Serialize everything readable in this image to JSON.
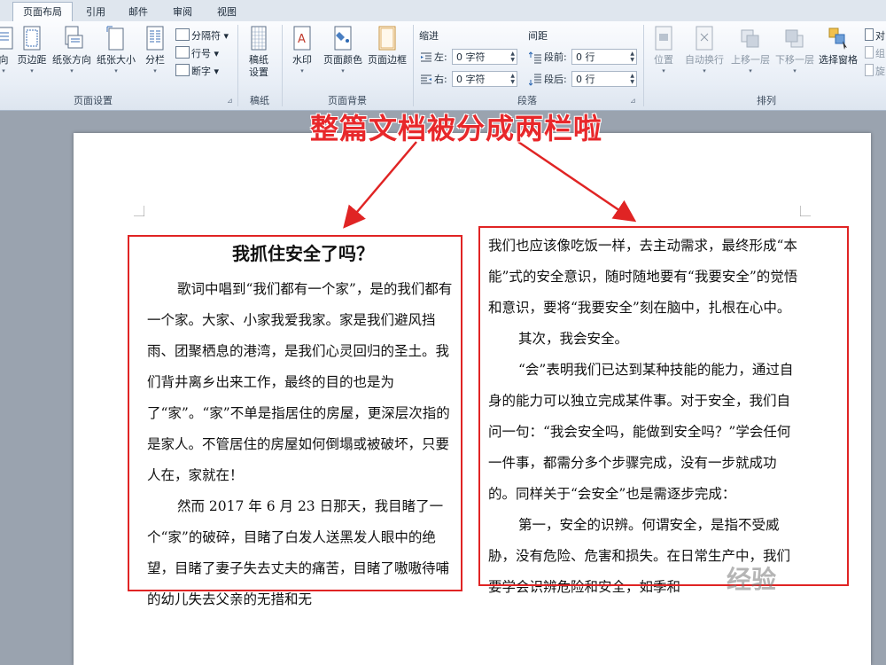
{
  "tabs": [
    "页面布局",
    "引用",
    "邮件",
    "审阅",
    "视图"
  ],
  "ribbon": {
    "page_setup": {
      "label": "页面设置",
      "buttons": [
        "向",
        "页边距",
        "纸张方向",
        "纸张大小",
        "分栏"
      ],
      "small": [
        "分隔符",
        "行号",
        "断字"
      ]
    },
    "draft": {
      "label": "稿纸",
      "button_line1": "稿纸",
      "button_line2": "设置"
    },
    "background": {
      "label": "页面背景",
      "buttons": [
        "水印",
        "页面颜色",
        "页面边框"
      ]
    },
    "paragraph": {
      "label": "段落",
      "indent_title": "缩进",
      "spacing_title": "间距",
      "left_label": "左:",
      "right_label": "右:",
      "before_label": "段前:",
      "after_label": "段后:",
      "left_value": "0 字符",
      "right_value": "0 字符",
      "before_value": "0 行",
      "after_value": "0 行"
    },
    "arrange": {
      "label": "排列",
      "buttons": [
        "位置",
        "自动换行",
        "上移一层",
        "下移一层",
        "选择窗格"
      ],
      "small": [
        "对",
        "组",
        "旋"
      ]
    }
  },
  "annotation": "整篇文档被分成两栏啦",
  "document": {
    "title": "我抓住安全了吗？",
    "left_column": [
      "歌词中唱到“我们都有一个家”，是的我们都有一个家。大家、小家我爱我家。家是我们避风挡雨、团聚栖息的港湾，是我们心灵回归的圣土。我们背井离乡出来工作，最终的目的也是为了“家”。“家”不单是指居住的房屋，更深层次指的是家人。不管居住的房屋如何倒塌或被破坏，只要人在，家就在！",
      "然而 2017 年 6 月 23 日那天，我目睹了一个“家”的破碎，目睹了白发人送黑发人眼中的绝望，目睹了妻子失去丈夫的痛苦，目睹了嗷嗷待哺的幼儿失去父亲的无措和无"
    ],
    "right_column": [
      "我们也应该像吃饭一样，去主动需求，最终形成“本能”式的安全意识，随时随地要有“我要安全”的觉悟和意识，要将“我要安全”刻在脑中，扎根在心中。",
      "其次，我会安全。",
      "“会”表明我们已达到某种技能的能力，通过自身的能力可以独立完成某件事。对于安全，我们自问一句：“我会安全吗，能做到安全吗？”学会任何一件事，都需分多个步骤完成，没有一步就成功的。同样关于“会安全”也是需逐步完成：",
      "第一，安全的识辨。何谓安全，是指不受威胁，没有危险、危害和损失。在日常生产中，我们要学会识辨危险和安全，如季和"
    ]
  },
  "watermark": "经验"
}
